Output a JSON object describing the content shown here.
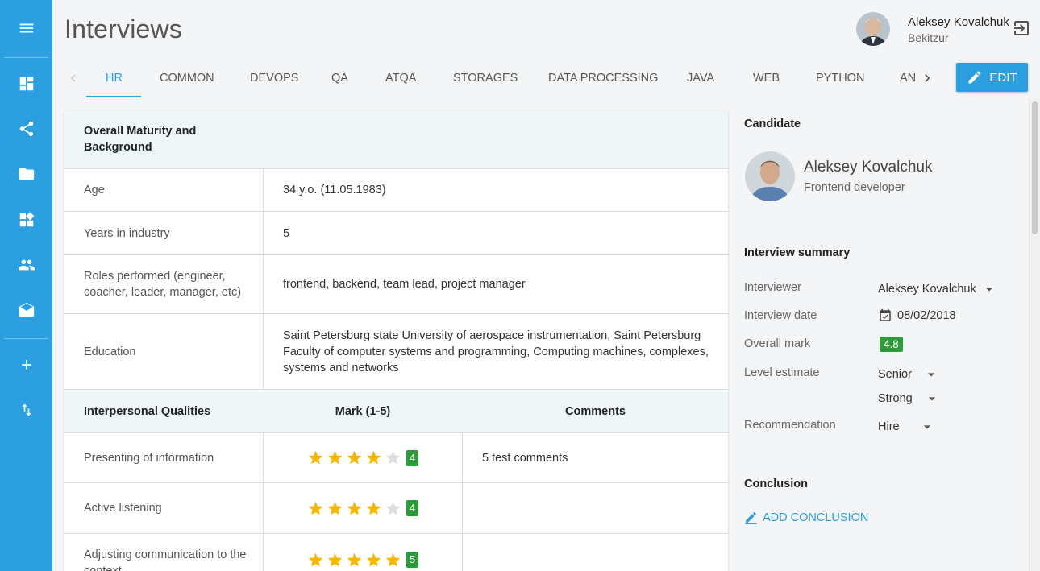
{
  "page": {
    "title": "Interviews"
  },
  "user": {
    "name": "Aleksey Kovalchuk",
    "company": "Bekitzur"
  },
  "tabs": [
    "HR",
    "COMMON",
    "DEVOPS",
    "QA",
    "ATQA",
    "STORAGES",
    "DATA PROCESSING",
    "JAVA",
    "WEB",
    "PYTHON",
    "AN"
  ],
  "toolbar": {
    "edit_label": "EDIT"
  },
  "background": {
    "header": "Overall Maturity and Background",
    "rows": [
      {
        "label": "Age",
        "value": "34 y.o.  (11.05.1983)"
      },
      {
        "label": "Years in industry",
        "value": "5"
      },
      {
        "label": "Roles performed (engineer, coacher, leader, manager, etc)",
        "value": "frontend, backend, team lead, project manager"
      },
      {
        "label": "Education",
        "value": "Saint Petersburg state University of aerospace instrumentation, Saint Petersburg Faculty of computer systems and programming, Computing machines, complexes, systems and networks"
      }
    ]
  },
  "qualities": {
    "header": {
      "col1": "Interpersonal Qualities",
      "col2": "Mark (1-5)",
      "col3": "Comments"
    },
    "rows": [
      {
        "label": "Presenting of information",
        "mark": "4",
        "stars": 4,
        "comment": "5 test comments"
      },
      {
        "label": "Active listening",
        "mark": "4",
        "stars": 4,
        "comment": ""
      },
      {
        "label": "Adjusting communication to the context",
        "mark": "5",
        "stars": 5,
        "comment": ""
      }
    ]
  },
  "candidate": {
    "heading": "Candidate",
    "name": "Aleksey Kovalchuk",
    "role": "Frontend developer"
  },
  "summary": {
    "heading": "Interview summary",
    "interviewer_label": "Interviewer",
    "interviewer": "Aleksey Kovalchuk",
    "date_label": "Interview date",
    "date": "08/02/2018",
    "mark_label": "Overall mark",
    "mark": "4.8",
    "level_label": "Level estimate",
    "level": "Senior",
    "level2": "Strong",
    "recommendation_label": "Recommendation",
    "recommendation": "Hire"
  },
  "conclusion": {
    "heading": "Conclusion",
    "add_label": "ADD CONCLUSION"
  },
  "colors": {
    "accent": "#2b9fe0",
    "success": "#2e9b3b",
    "star": "#f5b800"
  },
  "icons": [
    "menu-icon",
    "dashboard-icon",
    "share-icon",
    "folder-icon",
    "widgets-icon",
    "people-icon",
    "drafts-icon",
    "add-icon",
    "sort-icon",
    "logout-icon",
    "pencil-icon",
    "calendar-icon",
    "chevron-left-icon",
    "chevron-right-icon",
    "dropdown-arrow-icon",
    "star-icon"
  ]
}
